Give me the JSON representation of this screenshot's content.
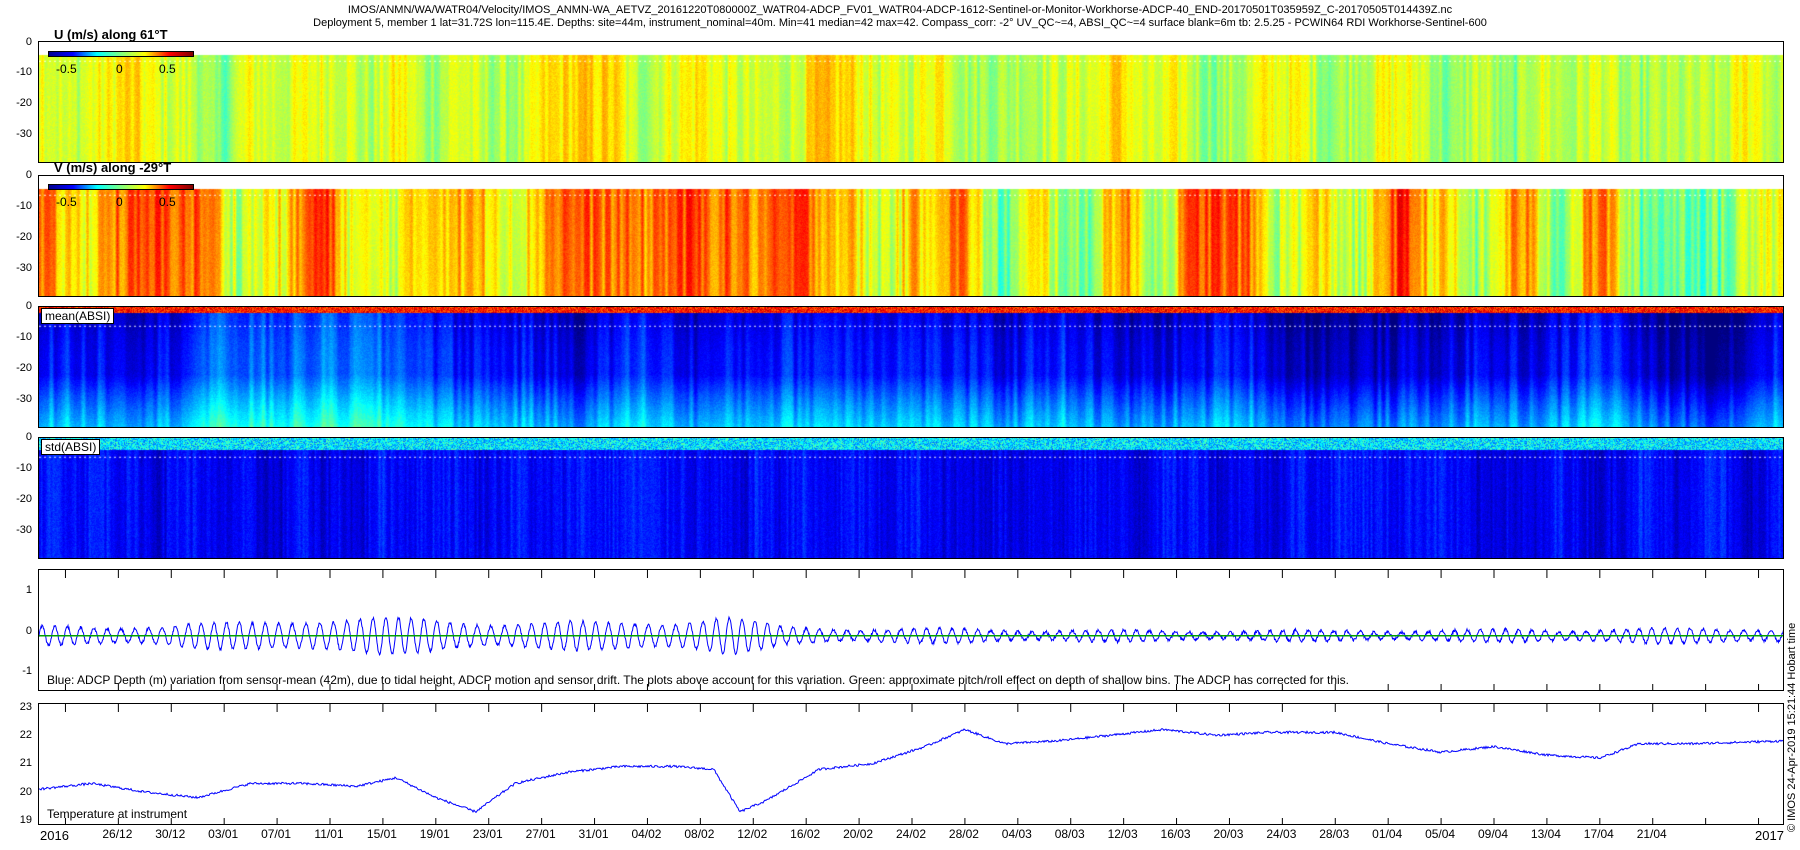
{
  "header": {
    "line1": "IMOS/ANMN/WA/WATR04/Velocity/IMOS_ANMN-WA_AETVZ_20161220T080000Z_WATR04-ADCP_FV01_WATR04-ADCP-1612-Sentinel-or-Monitor-Workhorse-ADCP-40_END-20170501T035959Z_C-20170505T014439Z.nc",
    "line2": "Deployment 5, member 1 lat=31.72S lon=115.4E. Depths: site=44m, instrument_nominal=40m. Min=41 median=42 max=42. Compass_corr: -2° UV_QC~=4, ABSI_QC~=4 surface blank=6m tb: 2.5.25 - PCWIN64 RDI Workhorse-Sentinel-600"
  },
  "side_note": "© IMOS 24-Apr-2019 15:21:44 Hobart time",
  "colorbar_ticks": [
    "-0.5",
    "0",
    "0.5"
  ],
  "depth_ticks": [
    "0",
    "-10",
    "-20",
    "-30"
  ],
  "panels": {
    "u": {
      "title": "U (m/s) along 61°T"
    },
    "v": {
      "title": "V (m/s) along -29°T"
    },
    "mean_absi": {
      "label": "mean(ABSI)"
    },
    "std_absi": {
      "label": "std(ABSI)"
    },
    "depth_var": {
      "yticks": [
        "1",
        "0",
        "-1"
      ],
      "note": "Blue: ADCP Depth (m) variation from sensor-mean (42m), due to tidal height, ADCP motion and sensor drift. The plots above account for this variation. Green: approximate pitch/roll effect on depth of shallow bins. The ADCP has corrected for this."
    },
    "temperature": {
      "yticks": [
        "23",
        "22",
        "21",
        "20",
        "19"
      ],
      "note": "Temperature at instrument"
    }
  },
  "x_axis": {
    "year_start": "2016",
    "year_end": "2017",
    "tick_labels": [
      "26/12",
      "30/12",
      "03/01",
      "07/01",
      "11/01",
      "15/01",
      "19/01",
      "23/01",
      "27/01",
      "31/01",
      "04/02",
      "08/02",
      "12/02",
      "16/02",
      "20/02",
      "24/02",
      "28/02",
      "04/03",
      "08/03",
      "12/03",
      "16/03",
      "20/03",
      "24/03",
      "28/03",
      "01/04",
      "05/04",
      "09/04",
      "13/04",
      "17/04",
      "21/04"
    ]
  },
  "colors": {
    "depth_line": "#0000ff",
    "pitch_roll_line": "#00a000",
    "temperature_line": "#0000ff"
  },
  "chart_data": [
    {
      "type": "heatmap",
      "title": "U (m/s) along 61°T",
      "ylabel": "",
      "ylim": [
        -39,
        0
      ],
      "colorbar": [
        -0.7,
        0.7
      ],
      "x_range": [
        "2016-12-20",
        "2017-05-01"
      ],
      "dominant_value_range": [
        -0.1,
        0.3
      ]
    },
    {
      "type": "heatmap",
      "title": "V (m/s) along -29°T",
      "ylim": [
        -39,
        0
      ],
      "colorbar": [
        -0.7,
        0.7
      ],
      "x_range": [
        "2016-12-20",
        "2017-05-01"
      ],
      "dominant_value_range": [
        -0.2,
        0.6
      ]
    },
    {
      "type": "heatmap",
      "title": "mean(ABSI)",
      "ylim": [
        -39,
        0
      ],
      "x_range": [
        "2016-12-20",
        "2017-05-01"
      ]
    },
    {
      "type": "heatmap",
      "title": "std(ABSI)",
      "ylim": [
        -39,
        0
      ],
      "x_range": [
        "2016-12-20",
        "2017-05-01"
      ]
    },
    {
      "type": "line",
      "title": "",
      "ylim": [
        -1.2,
        1.4
      ],
      "x_range": [
        "2016-12-20",
        "2017-05-01"
      ],
      "series": [
        {
          "values_envelope": {
            "dates": [
              "2016-12-20",
              "2017-01-05",
              "2017-01-10",
              "2017-01-20",
              "2017-02-01",
              "2017-02-10",
              "2017-02-14",
              "2017-03-01",
              "2017-03-15",
              "2017-04-01",
              "2017-04-30"
            ],
            "amplitude_m": [
              0.2,
              0.3,
              0.45,
              0.35,
              0.3,
              0.45,
              0.2,
              0.15,
              0.12,
              0.12,
              0.18
            ]
          }
        },
        {
          "values": [
            0,
            0
          ]
        }
      ]
    },
    {
      "type": "line",
      "title": "",
      "ylim": [
        18.8,
        23.1
      ],
      "series": [
        {
          "x": [
            "2016-12-20",
            "2016-12-24",
            "2016-12-28",
            "2017-01-01",
            "2017-01-05",
            "2017-01-09",
            "2017-01-13",
            "2017-01-16",
            "2017-01-19",
            "2017-01-22",
            "2017-01-25",
            "2017-01-29",
            "2017-02-02",
            "2017-02-06",
            "2017-02-09",
            "2017-02-11",
            "2017-02-13",
            "2017-02-17",
            "2017-02-21",
            "2017-02-25",
            "2017-02-28",
            "2017-03-03",
            "2017-03-07",
            "2017-03-11",
            "2017-03-15",
            "2017-03-19",
            "2017-03-23",
            "2017-03-28",
            "2017-04-01",
            "2017-04-05",
            "2017-04-09",
            "2017-04-13",
            "2017-04-17",
            "2017-04-20",
            "2017-04-24",
            "2017-05-01"
          ],
          "values": [
            20.1,
            20.3,
            20.0,
            19.8,
            20.3,
            20.3,
            20.2,
            20.5,
            19.8,
            19.3,
            20.3,
            20.7,
            20.9,
            20.9,
            20.8,
            19.3,
            19.7,
            20.8,
            21.0,
            21.6,
            22.2,
            21.7,
            21.8,
            22.0,
            22.2,
            22.0,
            22.1,
            22.1,
            21.7,
            21.4,
            21.6,
            21.3,
            21.2,
            21.7,
            21.7,
            21.8
          ]
        }
      ]
    }
  ]
}
